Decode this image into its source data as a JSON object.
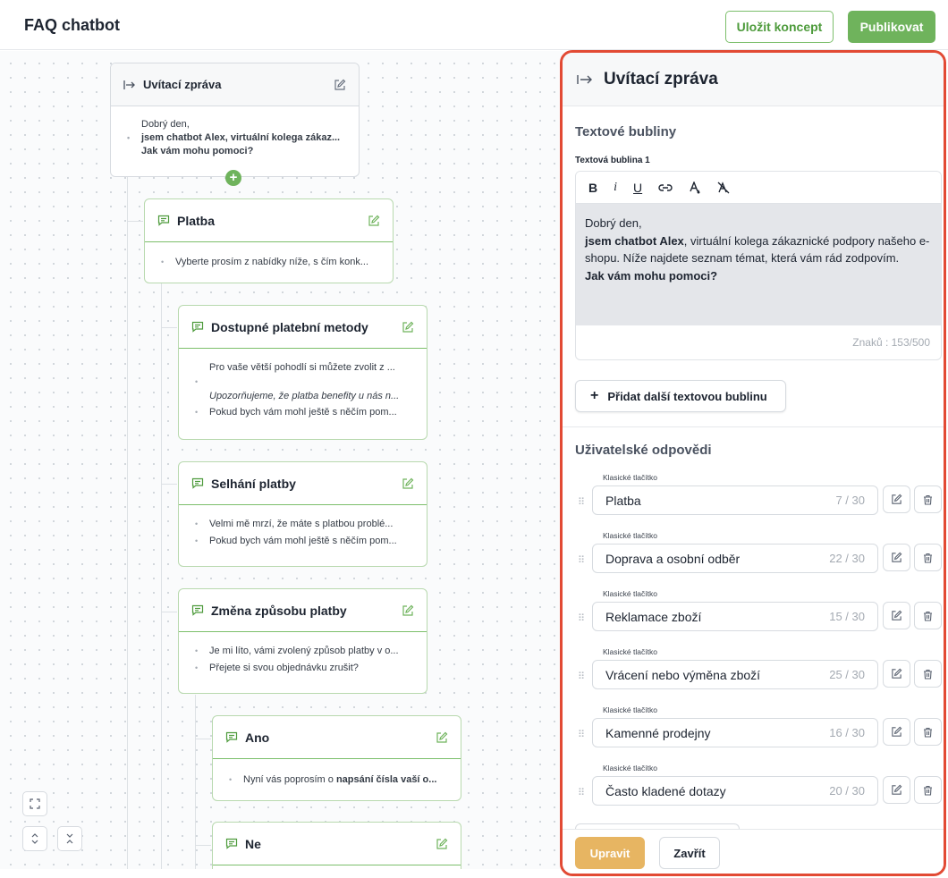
{
  "app": {
    "title": "FAQ chatbot"
  },
  "header": {
    "save_draft_label": "Uložit koncept",
    "publish_label": "Publikovat"
  },
  "canvas": {
    "nodes": [
      {
        "title": "Uvítací zpráva",
        "lines": [
          "Dobrý den,",
          "jsem chatbot Alex, virtuální kolega zákaz...",
          "Jak vám mohu pomoci?"
        ]
      },
      {
        "title": "Platba",
        "lines": [
          "Vyberte prosím z nabídky níže, s čím konk..."
        ]
      },
      {
        "title": "Dostupné platební metody",
        "lines": [
          "Pro vaše větší pohodlí si můžete zvolit z ...",
          "Upozorňujeme, že platba benefity u nás n...",
          "Pokud bych vám mohl ještě s něčím pom..."
        ]
      },
      {
        "title": "Selhání platby",
        "lines": [
          "Velmi mě mrzí, že máte s platbou problé...",
          "Pokud bych vám mohl ještě s něčím pom..."
        ]
      },
      {
        "title": "Změna způsobu platby",
        "lines": [
          "Je mi líto, vámi zvolený způsob platby v o...",
          "Přejete si svou objednávku zrušit?"
        ]
      },
      {
        "title": "Ano",
        "lines": [
          "Nyní vás poprosím o ",
          "napsání čísla vaší o..."
        ]
      },
      {
        "title": "Ne",
        "lines": []
      }
    ],
    "icons": {
      "entry": "arrow-to-line-icon",
      "message": "message-icon",
      "edit": "edit-icon",
      "fit": "fit-screen-icon",
      "expand": "expand-icon",
      "collapse": "collapse-icon"
    }
  },
  "panel": {
    "title": "Uvítací zpráva",
    "text_bubbles_title": "Textové bubliny",
    "bubble_label": "Textová bublina 1",
    "toolbar": {
      "bold": "B",
      "italic": "i",
      "underline": "U"
    },
    "bubble_text": {
      "line1": "Dobrý den,",
      "bold_part": "jsem chatbot Alex",
      "rest": ", virtuální kolega zákaznické podpory našeho e-shopu. Níže najdete seznam témat, která vám rád zodpovím.",
      "question": "Jak vám mohu pomoci?"
    },
    "char_count": "Znaků : 153/500",
    "add_bubble_label": "Přidat další textovou bublinu",
    "responses_title": "Uživatelské odpovědi",
    "responses": [
      {
        "type": "Klasické tlačítko",
        "value": "Platba",
        "count": "7 / 30"
      },
      {
        "type": "Klasické tlačítko",
        "value": "Doprava a osobní odběr",
        "count": "22 / 30"
      },
      {
        "type": "Klasické tlačítko",
        "value": "Reklamace zboží",
        "count": "15 / 30"
      },
      {
        "type": "Klasické tlačítko",
        "value": "Vrácení nebo výměna zboží",
        "count": "25 / 30"
      },
      {
        "type": "Klasické tlačítko",
        "value": "Kamenné prodejny",
        "count": "16 / 30"
      },
      {
        "type": "Klasické tlačítko",
        "value": "Často kladené dotazy",
        "count": "20 / 30"
      }
    ],
    "footer": {
      "edit_label": "Upravit",
      "close_label": "Zavřít"
    }
  },
  "colors": {
    "accent_green": "#6fb35c",
    "highlight_border": "#e24a34",
    "edit_button": "#e7b562"
  }
}
